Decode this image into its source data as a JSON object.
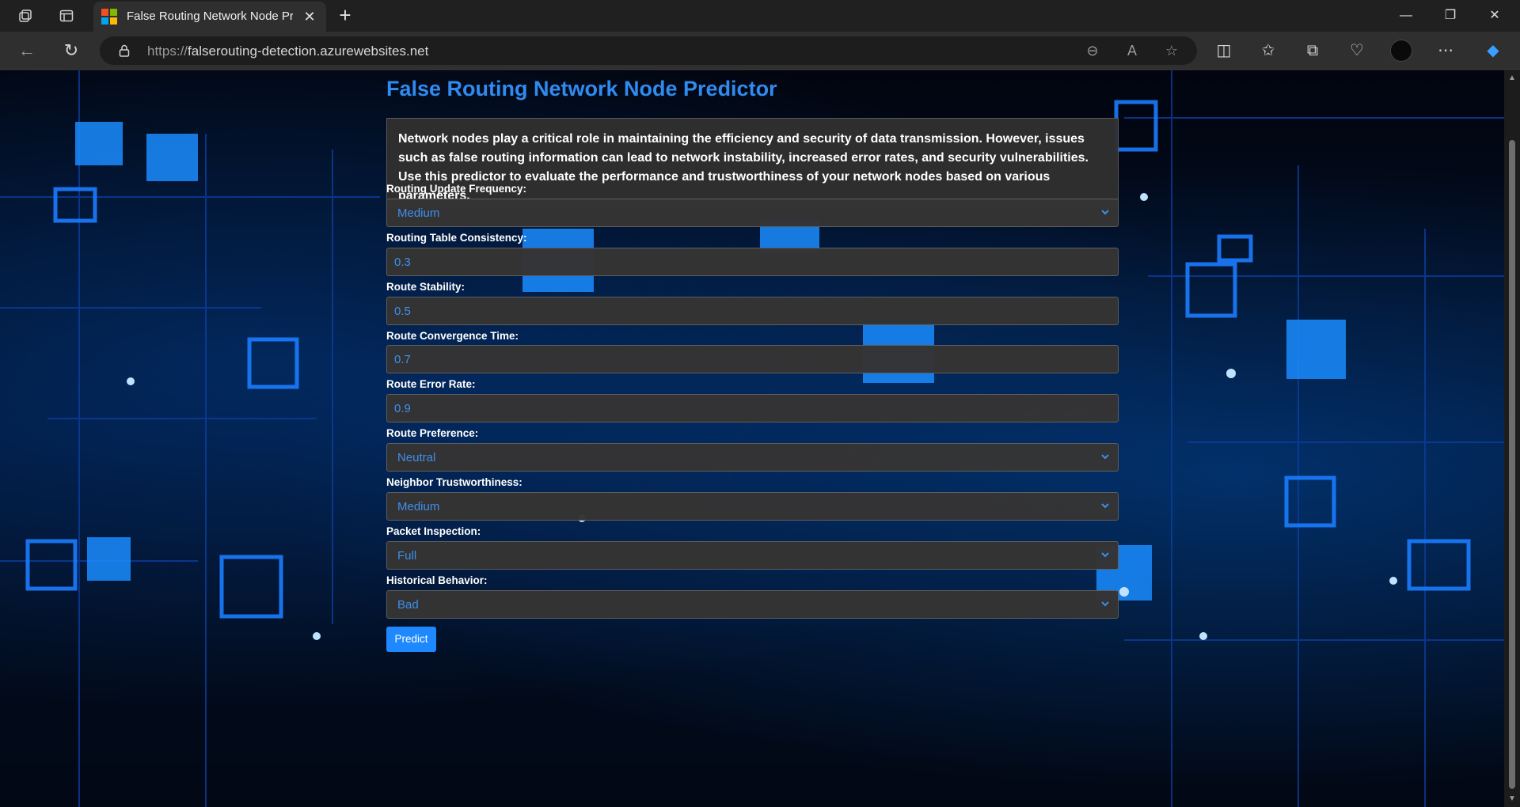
{
  "browser": {
    "tab_title": "False Routing Network Node Predictor",
    "url_protocol": "https://",
    "url_host": "falserouting-detection.azurewebsites.net"
  },
  "page": {
    "title": "False Routing Network Node Predictor",
    "intro": "Network nodes play a critical role in maintaining the efficiency and security of data transmission. However, issues such as false routing information can lead to network instability, increased error rates, and security vulnerabilities. Use this predictor to evaluate the performance and trustworthiness of your network nodes based on various parameters.",
    "fields": [
      {
        "label": "Routing Update Frequency:",
        "type": "select",
        "value": "Medium"
      },
      {
        "label": "Routing Table Consistency:",
        "type": "input",
        "value": "0.3"
      },
      {
        "label": "Route Stability:",
        "type": "input",
        "value": "0.5"
      },
      {
        "label": "Route Convergence Time:",
        "type": "input",
        "value": "0.7"
      },
      {
        "label": "Route Error Rate:",
        "type": "input",
        "value": "0.9"
      },
      {
        "label": "Route Preference:",
        "type": "select",
        "value": "Neutral"
      },
      {
        "label": "Neighbor Trustworthiness:",
        "type": "select",
        "value": "Medium"
      },
      {
        "label": "Packet Inspection:",
        "type": "select",
        "value": "Full"
      },
      {
        "label": "Historical Behavior:",
        "type": "select",
        "value": "Bad"
      }
    ],
    "predict_label": "Predict"
  },
  "colors": {
    "accent": "#2f8bf0",
    "button": "#1e88ff",
    "field_bg": "#343434"
  }
}
